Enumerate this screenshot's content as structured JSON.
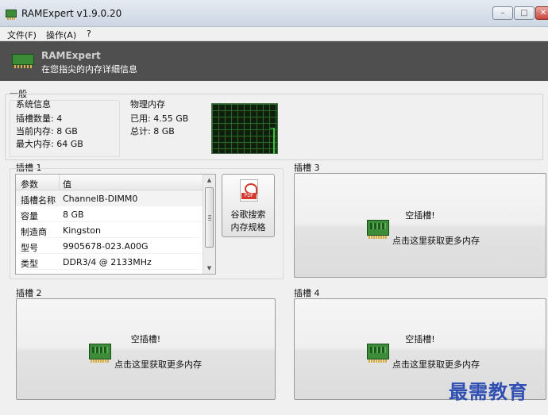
{
  "window": {
    "title": "RAMExpert v1.9.0.20",
    "minimize_glyph": "–",
    "maximize_glyph": "□",
    "close_glyph": "✕"
  },
  "menu": [
    "文件(F)",
    "操作(A)",
    "?"
  ],
  "banner": {
    "title": "RAMExpert",
    "subtitle": "在您指尖的内存详细信息"
  },
  "general": {
    "label": "一般",
    "system_info": {
      "label": "系统信息",
      "slots_count": "插槽数量: 4",
      "current_memory": "当前内存: 8 GB",
      "max_memory": "最大内存: 64 GB"
    },
    "physical_memory": {
      "label": "物理内存",
      "used": "已用: 4.55 GB",
      "total": "总计: 8 GB"
    }
  },
  "slot1": {
    "label": "插槽 1",
    "headers": [
      "参数",
      "值"
    ],
    "rows": [
      [
        "插槽名称",
        "ChannelB-DIMM0"
      ],
      [
        "容量",
        "8 GB"
      ],
      [
        "制造商",
        "Kingston"
      ],
      [
        "型号",
        "9905678-023.A00G"
      ],
      [
        "类型",
        "DDR3/4 @ 2133MHz"
      ]
    ],
    "pdf_button": {
      "tag": "PDF",
      "line1": "谷歌搜索",
      "line2": "内存规格"
    }
  },
  "slot2": {
    "label": "插槽 2",
    "empty": "空插槽!",
    "more": "点击这里获取更多内存"
  },
  "slot3": {
    "label": "插槽 3",
    "empty": "空插槽!",
    "more": "点击这里获取更多内存"
  },
  "slot4": {
    "label": "插槽 4",
    "empty": "空插槽!",
    "more": "点击这里获取更多内存"
  },
  "scroll": {
    "up": "▲",
    "down": "▼"
  },
  "watermark": "最需教育"
}
